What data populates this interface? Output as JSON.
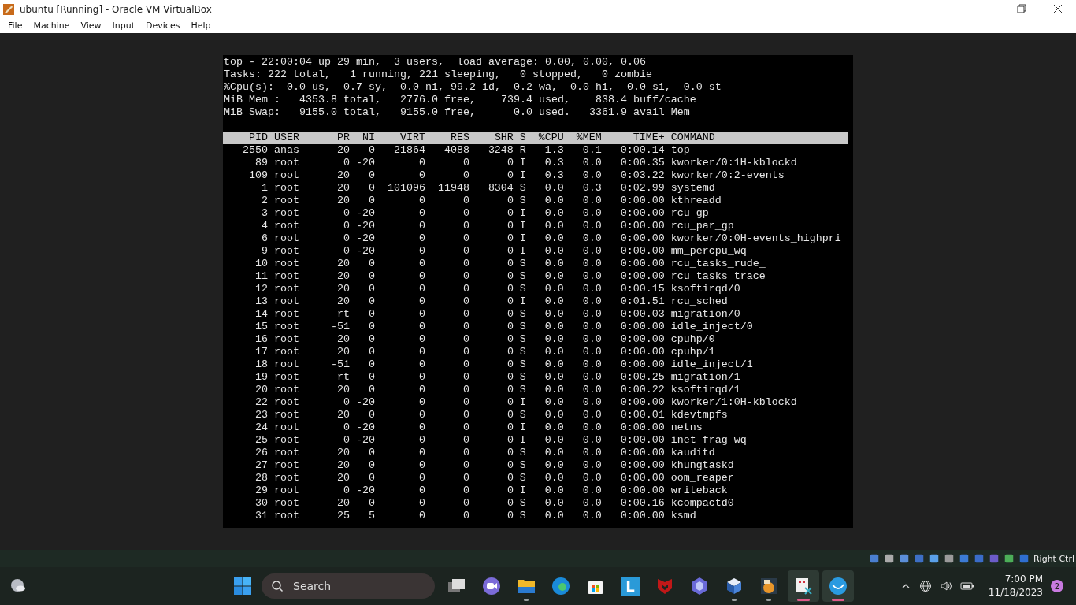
{
  "window": {
    "title": "ubuntu [Running] - Oracle VM VirtualBox"
  },
  "menu": [
    "File",
    "Machine",
    "View",
    "Input",
    "Devices",
    "Help"
  ],
  "terminal": {
    "summary_lines": [
      "top - 22:00:04 up 29 min,  3 users,  load average: 0.00, 0.00, 0.06",
      "Tasks: 222 total,   1 running, 221 sleeping,   0 stopped,   0 zombie",
      "%Cpu(s):  0.0 us,  0.7 sy,  0.0 ni, 99.2 id,  0.2 wa,  0.0 hi,  0.0 si,  0.0 st",
      "MiB Mem :   4353.8 total,   2776.0 free,    739.4 used,    838.4 buff/cache",
      "MiB Swap:   9155.0 total,   9155.0 free,      0.0 used.   3361.9 avail Mem"
    ],
    "columns": [
      "PID",
      "USER",
      "PR",
      "NI",
      "VIRT",
      "RES",
      "SHR",
      "S",
      "%CPU",
      "%MEM",
      "TIME+",
      "COMMAND"
    ],
    "rows": [
      [
        "2550",
        "anas",
        "20",
        "0",
        "21864",
        "4088",
        "3248",
        "R",
        "1.3",
        "0.1",
        "0:00.14",
        "top"
      ],
      [
        "89",
        "root",
        "0",
        "-20",
        "0",
        "0",
        "0",
        "I",
        "0.3",
        "0.0",
        "0:00.35",
        "kworker/0:1H-kblockd"
      ],
      [
        "109",
        "root",
        "20",
        "0",
        "0",
        "0",
        "0",
        "I",
        "0.3",
        "0.0",
        "0:03.22",
        "kworker/0:2-events"
      ],
      [
        "1",
        "root",
        "20",
        "0",
        "101096",
        "11948",
        "8304",
        "S",
        "0.0",
        "0.3",
        "0:02.99",
        "systemd"
      ],
      [
        "2",
        "root",
        "20",
        "0",
        "0",
        "0",
        "0",
        "S",
        "0.0",
        "0.0",
        "0:00.00",
        "kthreadd"
      ],
      [
        "3",
        "root",
        "0",
        "-20",
        "0",
        "0",
        "0",
        "I",
        "0.0",
        "0.0",
        "0:00.00",
        "rcu_gp"
      ],
      [
        "4",
        "root",
        "0",
        "-20",
        "0",
        "0",
        "0",
        "I",
        "0.0",
        "0.0",
        "0:00.00",
        "rcu_par_gp"
      ],
      [
        "6",
        "root",
        "0",
        "-20",
        "0",
        "0",
        "0",
        "I",
        "0.0",
        "0.0",
        "0:00.00",
        "kworker/0:0H-events_highpri"
      ],
      [
        "9",
        "root",
        "0",
        "-20",
        "0",
        "0",
        "0",
        "I",
        "0.0",
        "0.0",
        "0:00.00",
        "mm_percpu_wq"
      ],
      [
        "10",
        "root",
        "20",
        "0",
        "0",
        "0",
        "0",
        "S",
        "0.0",
        "0.0",
        "0:00.00",
        "rcu_tasks_rude_"
      ],
      [
        "11",
        "root",
        "20",
        "0",
        "0",
        "0",
        "0",
        "S",
        "0.0",
        "0.0",
        "0:00.00",
        "rcu_tasks_trace"
      ],
      [
        "12",
        "root",
        "20",
        "0",
        "0",
        "0",
        "0",
        "S",
        "0.0",
        "0.0",
        "0:00.15",
        "ksoftirqd/0"
      ],
      [
        "13",
        "root",
        "20",
        "0",
        "0",
        "0",
        "0",
        "I",
        "0.0",
        "0.0",
        "0:01.51",
        "rcu_sched"
      ],
      [
        "14",
        "root",
        "rt",
        "0",
        "0",
        "0",
        "0",
        "S",
        "0.0",
        "0.0",
        "0:00.03",
        "migration/0"
      ],
      [
        "15",
        "root",
        "-51",
        "0",
        "0",
        "0",
        "0",
        "S",
        "0.0",
        "0.0",
        "0:00.00",
        "idle_inject/0"
      ],
      [
        "16",
        "root",
        "20",
        "0",
        "0",
        "0",
        "0",
        "S",
        "0.0",
        "0.0",
        "0:00.00",
        "cpuhp/0"
      ],
      [
        "17",
        "root",
        "20",
        "0",
        "0",
        "0",
        "0",
        "S",
        "0.0",
        "0.0",
        "0:00.00",
        "cpuhp/1"
      ],
      [
        "18",
        "root",
        "-51",
        "0",
        "0",
        "0",
        "0",
        "S",
        "0.0",
        "0.0",
        "0:00.00",
        "idle_inject/1"
      ],
      [
        "19",
        "root",
        "rt",
        "0",
        "0",
        "0",
        "0",
        "S",
        "0.0",
        "0.0",
        "0:00.25",
        "migration/1"
      ],
      [
        "20",
        "root",
        "20",
        "0",
        "0",
        "0",
        "0",
        "S",
        "0.0",
        "0.0",
        "0:00.22",
        "ksoftirqd/1"
      ],
      [
        "22",
        "root",
        "0",
        "-20",
        "0",
        "0",
        "0",
        "I",
        "0.0",
        "0.0",
        "0:00.00",
        "kworker/1:0H-kblockd"
      ],
      [
        "23",
        "root",
        "20",
        "0",
        "0",
        "0",
        "0",
        "S",
        "0.0",
        "0.0",
        "0:00.01",
        "kdevtmpfs"
      ],
      [
        "24",
        "root",
        "0",
        "-20",
        "0",
        "0",
        "0",
        "I",
        "0.0",
        "0.0",
        "0:00.00",
        "netns"
      ],
      [
        "25",
        "root",
        "0",
        "-20",
        "0",
        "0",
        "0",
        "I",
        "0.0",
        "0.0",
        "0:00.00",
        "inet_frag_wq"
      ],
      [
        "26",
        "root",
        "20",
        "0",
        "0",
        "0",
        "0",
        "S",
        "0.0",
        "0.0",
        "0:00.00",
        "kauditd"
      ],
      [
        "27",
        "root",
        "20",
        "0",
        "0",
        "0",
        "0",
        "S",
        "0.0",
        "0.0",
        "0:00.00",
        "khungtaskd"
      ],
      [
        "28",
        "root",
        "20",
        "0",
        "0",
        "0",
        "0",
        "S",
        "0.0",
        "0.0",
        "0:00.00",
        "oom_reaper"
      ],
      [
        "29",
        "root",
        "0",
        "-20",
        "0",
        "0",
        "0",
        "I",
        "0.0",
        "0.0",
        "0:00.00",
        "writeback"
      ],
      [
        "30",
        "root",
        "20",
        "0",
        "0",
        "0",
        "0",
        "S",
        "0.0",
        "0.0",
        "0:00.16",
        "kcompactd0"
      ],
      [
        "31",
        "root",
        "25",
        "5",
        "0",
        "0",
        "0",
        "S",
        "0.0",
        "0.0",
        "0:00.00",
        "ksmd"
      ]
    ]
  },
  "vm_status": {
    "icons": [
      {
        "kind": "disk"
      },
      {
        "kind": "optical"
      },
      {
        "kind": "audio"
      },
      {
        "kind": "network"
      },
      {
        "kind": "usb"
      },
      {
        "kind": "folder"
      },
      {
        "kind": "display"
      },
      {
        "kind": "capture"
      },
      {
        "kind": "cpu"
      },
      {
        "kind": "mouse"
      },
      {
        "kind": "keyboard"
      }
    ],
    "host_key": "Right Ctrl"
  },
  "taskbar": {
    "search": {
      "placeholder": "Search"
    },
    "apps": [
      {
        "kind": "task-view",
        "running": false,
        "active": false
      },
      {
        "kind": "chat",
        "running": false,
        "active": false
      },
      {
        "kind": "folder",
        "running": true,
        "active": false
      },
      {
        "kind": "browser",
        "running": false,
        "active": false
      },
      {
        "kind": "store",
        "running": false,
        "active": false
      },
      {
        "kind": "letter",
        "label": "L",
        "running": false,
        "active": false
      },
      {
        "kind": "shield",
        "running": false,
        "active": false
      },
      {
        "kind": "copilot",
        "running": false,
        "active": false
      },
      {
        "kind": "cube",
        "running": true,
        "active": false
      },
      {
        "kind": "game",
        "running": true,
        "active": false
      },
      {
        "kind": "tool",
        "running": true,
        "active": true
      },
      {
        "kind": "circle-app",
        "running": true,
        "active": true
      }
    ],
    "time": "7:00 PM",
    "date": "11/18/2023",
    "notifications": "2"
  }
}
